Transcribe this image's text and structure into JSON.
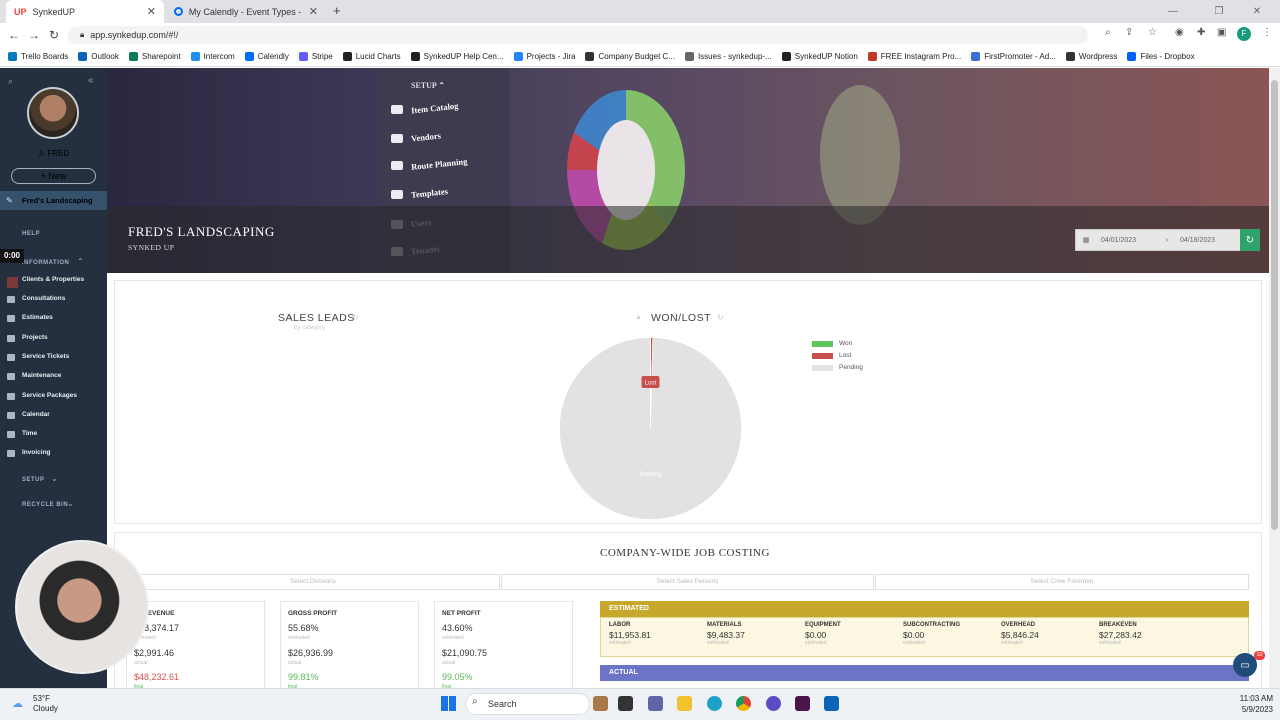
{
  "browser": {
    "tabs": [
      {
        "title": "SynkedUP",
        "favicon": "up-logo"
      },
      {
        "title": "My Calendly - Event Types - Cale",
        "favicon": "calendly-icon"
      }
    ],
    "url": "app.synkedup.com/#!/",
    "profile_initial": "F"
  },
  "bookmarks": [
    "Trello Boards",
    "Outlook",
    "Sharepoint",
    "Intercom",
    "Calendly",
    "Stripe",
    "Lucid Charts",
    "SynkedUP Help Cen...",
    "Projects - Jira",
    "Company Budget C...",
    "Issues - synkedup-...",
    "SynkedUP Notion",
    "FREE Instagram Pro...",
    "FirstPromoter - Ad...",
    "Wordpress",
    "Files - Dropbox"
  ],
  "bookmark_colors": [
    "#0079bf",
    "#0a64b7",
    "#0e7a5c",
    "#1f8ded",
    "#006bff",
    "#635bff",
    "#222",
    "#222",
    "#2684ff",
    "#333",
    "#666",
    "#222",
    "#c0392b",
    "#3b6fd8",
    "#333",
    "#0061fe"
  ],
  "sidebar": {
    "user": "FRED",
    "new_label": "+ New",
    "account": "Fred's Landscaping",
    "help": "HELP",
    "information": "INFORMATION",
    "timer": "0:00",
    "items": [
      "Clients & Properties",
      "Consultations",
      "Estimates",
      "Projects",
      "Service Tickets",
      "Maintenance",
      "Service Packages",
      "Calendar",
      "Time",
      "Invoicing"
    ],
    "setup": "SETUP",
    "recycle": "RECYCLE BIN"
  },
  "banner": {
    "menu_header": "SETUP",
    "menu_items": [
      "Item Catalog",
      "Vendors",
      "Route Planning",
      "Templates",
      "Users",
      "Tenants"
    ],
    "company": "FRED'S LANDSCAPING",
    "subtitle": "SYNKED UP",
    "date_from": "04/01/2023",
    "date_to": "04/18/2023"
  },
  "sales_leads": {
    "title": "SALES LEADS",
    "note": "by category"
  },
  "chart_data": {
    "type": "pie",
    "title": "WON/LOST",
    "categories": [
      "Won",
      "Lost",
      "Pending"
    ],
    "values": [
      0,
      0.4,
      99.6
    ],
    "colors": [
      "#5cc65a",
      "#c8504c",
      "#e2e2e2"
    ],
    "slice_labels": [
      "Lost",
      "Pending"
    ],
    "legend_placement": "right"
  },
  "job_costing": {
    "title": "COMPANY-WIDE JOB COSTING",
    "filters": [
      "Select Divisions",
      "Select Sales Persons",
      "Select Crew Foremen"
    ],
    "cards": [
      {
        "label": "REVENUE",
        "estimated": "$48,374.17",
        "actual": "$2,991.46",
        "final": "$48,232.61"
      },
      {
        "label": "GROSS PROFIT",
        "estimated": "55.68%",
        "actual": "$26,936.99",
        "final": "99.81%"
      },
      {
        "label": "NET PROFIT",
        "estimated": "43.60%",
        "actual": "$21,090.75",
        "final": "99.05%"
      }
    ],
    "est_word": "estimated",
    "act_word": "actual",
    "final_word": "final",
    "estimated_header": "ESTIMATED",
    "estimated": [
      {
        "label": "LABOR",
        "value": "$11,953.81"
      },
      {
        "label": "MATERIALS",
        "value": "$9,483.37"
      },
      {
        "label": "EQUIPMENT",
        "value": "$0.00"
      },
      {
        "label": "SUBCONTRACTING",
        "value": "$0.00"
      },
      {
        "label": "OVERHEAD",
        "value": "$5,846.24"
      },
      {
        "label": "BREAKEVEN",
        "value": "$27,283.42"
      }
    ],
    "actual_header": "ACTUAL",
    "chat_badge": "10"
  },
  "taskbar": {
    "temp": "53°F",
    "condition": "Cloudy",
    "search": "Search",
    "time": "11:03 AM",
    "date": "5/9/2023"
  }
}
